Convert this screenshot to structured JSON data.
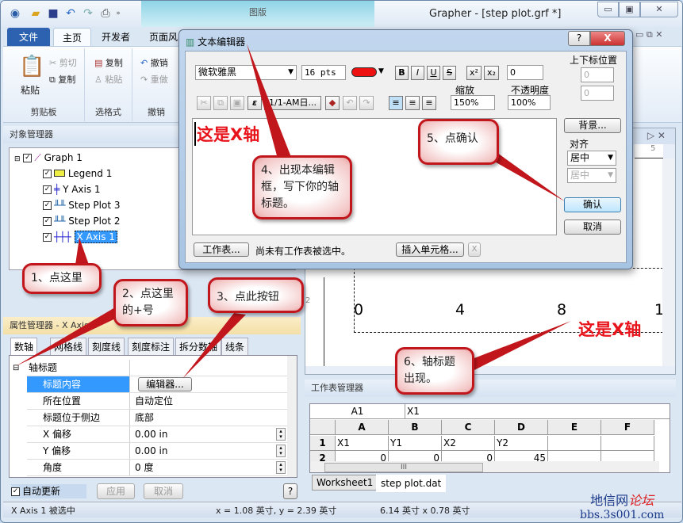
{
  "app": {
    "title": "Grapher - [step plot.grf *]",
    "context_tab": "图版",
    "window_buttons": [
      "minimize",
      "restore",
      "close"
    ]
  },
  "qat": {
    "icons": [
      "app-orb-icon",
      "open-folder-icon",
      "save-icon",
      "undo-icon",
      "redo-icon",
      "print-icon",
      "more-icon"
    ]
  },
  "ribbon": {
    "tabs": [
      {
        "label": "文件"
      },
      {
        "label": "主页"
      },
      {
        "label": "开发者"
      },
      {
        "label": "页面风"
      }
    ],
    "groups": [
      {
        "label": "剪贴板",
        "items": [
          "粘贴",
          "剪切",
          "复制"
        ]
      },
      {
        "label": "选格式",
        "items": [
          "复制",
          "粘贴"
        ]
      },
      {
        "label": "撤销",
        "items": [
          "撤销",
          "重做"
        ]
      }
    ]
  },
  "object_manager": {
    "title": "对象管理器",
    "items": [
      "Graph 1",
      "Legend 1",
      "Y Axis 1",
      "Step Plot 3",
      "Step Plot 2",
      "X Axis 1"
    ],
    "selected": "X Axis 1"
  },
  "plot": {
    "ruler_label": "5",
    "axis_ticks": [
      "0",
      "4",
      "8",
      "1"
    ],
    "left_ruler_label": "2",
    "axis_title": "这是X轴",
    "axis_title_color": "#e8141b"
  },
  "property_manager": {
    "title": "属性管理器 - X Axis 1",
    "tabs": [
      "数轴",
      "网格线",
      "刻度线",
      "刻度标注",
      "拆分数轴",
      "线条"
    ],
    "section": "轴标题",
    "rows": [
      {
        "key": "标题内容",
        "value": "编辑器..."
      },
      {
        "key": "所在位置",
        "value": "自动定位"
      },
      {
        "key": "标题位于侧边",
        "value": "底部"
      },
      {
        "key": "X 偏移",
        "value": "0.00 in"
      },
      {
        "key": "Y 偏移",
        "value": "0.00 in"
      },
      {
        "key": "角度",
        "value": "0 度"
      }
    ],
    "auto_update": "自动更新",
    "apply": "应用",
    "cancel": "取消",
    "help": "?"
  },
  "worksheet_manager": {
    "title": "工作表管理器",
    "cell_ref": "A1",
    "cell_value": "X1",
    "columns": [
      "A",
      "B",
      "C",
      "D",
      "E",
      "F"
    ],
    "rows": [
      {
        "num": "1",
        "cells": [
          "X1",
          "Y1",
          "X2",
          "Y2",
          "",
          ""
        ]
      },
      {
        "num": "2",
        "cells": [
          "0",
          "0",
          "0",
          "45",
          "",
          ""
        ]
      }
    ],
    "tabs": [
      "Worksheet1",
      "step plot.dat"
    ],
    "scroll_mark": "III"
  },
  "text_editor": {
    "title": "文本编辑器",
    "help": "?",
    "close": "X",
    "font": "微软雅黑",
    "size": "16 pts",
    "color": "#ee1111",
    "format_buttons": [
      "B",
      "I",
      "U",
      "S"
    ],
    "super": "x²",
    "sub": "x₂",
    "line_spacing": "0",
    "sub_pos_label": "上下标位置",
    "sub_h": "0",
    "sub_v": "0",
    "date_button": "1/1-AM日...",
    "zoom_label": "缩放",
    "zoom": "150%",
    "opacity_label": "不透明度",
    "opacity": "100%",
    "content": "这是X轴",
    "background": "背景...",
    "align_label": "对齐",
    "align_h": "居中",
    "align_v": "居中",
    "ok": "确认",
    "cancel": "取消",
    "worksheet_btn": "工作表...",
    "worksheet_status": "尚未有工作表被选中。",
    "insert_cell": "插入单元格...",
    "clear": "X"
  },
  "callouts": [
    "1、点这里",
    "2、点这里的+号",
    "3、点此按钮",
    "4、出现本编辑框，写下你的轴标题。",
    "5、点确认",
    "6、轴标题出现。"
  ],
  "status": {
    "selection": "X Axis 1 被选中",
    "cursor": "x = 1.08 英寸, y = 2.39 英寸",
    "size": "6.14 英寸 x 0.78 英寸"
  },
  "watermark": {
    "line1": "地信网",
    "line1b": "论坛",
    "line2": "bbs.3s001.com"
  }
}
